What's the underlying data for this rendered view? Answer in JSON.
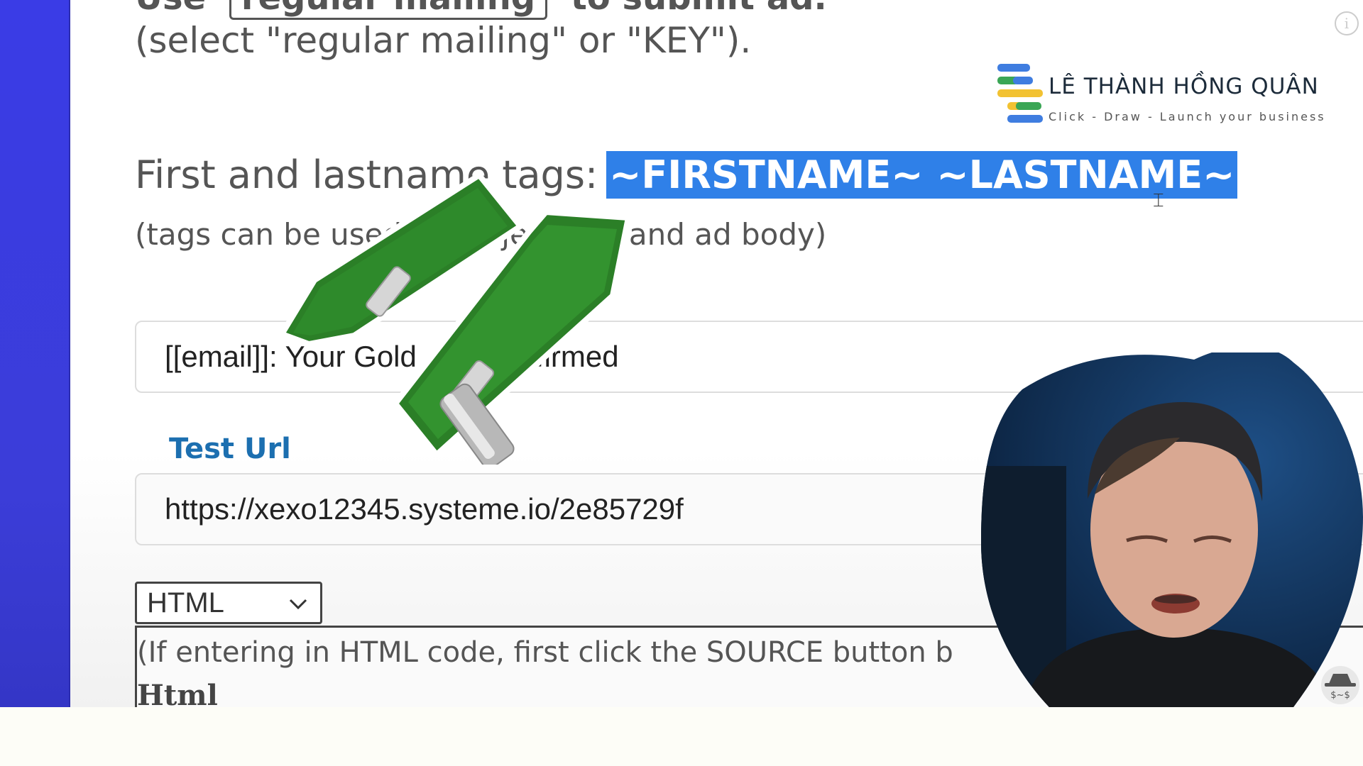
{
  "page": {
    "cutoff_prefix": "Use",
    "cutoff_button": "regular mailing",
    "cutoff_suffix": "to submit ad.",
    "select_hint": "(select \"regular mailing\" or \"KEY\").",
    "tags_label": "First and lastname tags:",
    "tags_value": "~FIRSTNAME~ ~LASTNAME~",
    "tags_note": "(tags can be used in subject line and ad body)",
    "subject_value": "[[email]]: Your Gold ... is confirmed",
    "test_url_label": "Test Url",
    "test_url_value": "https://xexo12345.systeme.io/2e85729f",
    "format_selected": "HTML",
    "editor_hint": "(If entering in HTML code, first click the SOURCE button b",
    "editor_label": "Html"
  },
  "brand": {
    "name": "LÊ THÀNH HỒNG QUÂN",
    "tagline": "Click - Draw - Launch your business",
    "colors": [
      "#3f7de0",
      "#3aa655",
      "#f2c232",
      "#3f7de0",
      "#3aa655"
    ]
  },
  "icons": {
    "info": "info-icon",
    "cursor": "text-cursor-icon",
    "signpost": "signpost-icon",
    "spy": "spy-hat-icon",
    "chevron": "chevron-down-icon"
  },
  "accent": {
    "sidebar": "#3a3ce6",
    "highlight": "#2f80e8",
    "label": "#1c6fb0",
    "sign_green": "#2e8a2b"
  }
}
